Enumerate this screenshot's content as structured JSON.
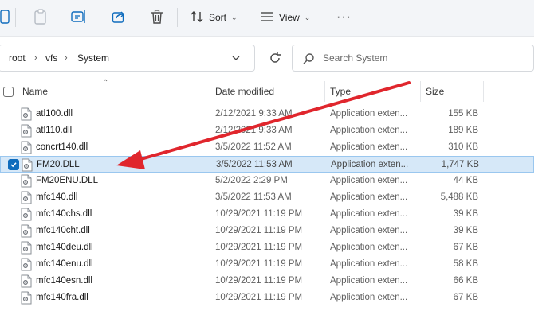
{
  "toolbar": {
    "sort_label": "Sort",
    "view_label": "View",
    "more_label": "···"
  },
  "address": {
    "crumbs": [
      "root",
      "vfs",
      "System"
    ]
  },
  "search": {
    "placeholder": "Search System"
  },
  "columns": {
    "name": "Name",
    "date": "Date modified",
    "type": "Type",
    "size": "Size"
  },
  "files": [
    {
      "name": "atl100.dll",
      "date": "2/12/2021 9:33 AM",
      "type": "Application exten...",
      "size": "155 KB"
    },
    {
      "name": "atl110.dll",
      "date": "2/12/2021 9:33 AM",
      "type": "Application exten...",
      "size": "189 KB"
    },
    {
      "name": "concrt140.dll",
      "date": "3/5/2022 11:52 AM",
      "type": "Application exten...",
      "size": "310 KB"
    },
    {
      "name": "FM20.DLL",
      "date": "3/5/2022 11:53 AM",
      "type": "Application exten...",
      "size": "1,747 KB",
      "selected": true
    },
    {
      "name": "FM20ENU.DLL",
      "date": "5/2/2022 2:29 PM",
      "type": "Application exten...",
      "size": "44 KB"
    },
    {
      "name": "mfc140.dll",
      "date": "3/5/2022 11:53 AM",
      "type": "Application exten...",
      "size": "5,488 KB"
    },
    {
      "name": "mfc140chs.dll",
      "date": "10/29/2021 11:19 PM",
      "type": "Application exten...",
      "size": "39 KB"
    },
    {
      "name": "mfc140cht.dll",
      "date": "10/29/2021 11:19 PM",
      "type": "Application exten...",
      "size": "39 KB"
    },
    {
      "name": "mfc140deu.dll",
      "date": "10/29/2021 11:19 PM",
      "type": "Application exten...",
      "size": "67 KB"
    },
    {
      "name": "mfc140enu.dll",
      "date": "10/29/2021 11:19 PM",
      "type": "Application exten...",
      "size": "58 KB"
    },
    {
      "name": "mfc140esn.dll",
      "date": "10/29/2021 11:19 PM",
      "type": "Application exten...",
      "size": "66 KB"
    },
    {
      "name": "mfc140fra.dll",
      "date": "10/29/2021 11:19 PM",
      "type": "Application exten...",
      "size": "67 KB"
    }
  ],
  "colors": {
    "accent": "#0f6cbd",
    "selection_bg": "#d6e8f8",
    "arrow": "#e0262d"
  },
  "icons": [
    "new-icon",
    "paste-icon",
    "rename-icon",
    "share-icon",
    "delete-icon",
    "sort-icon",
    "view-icon",
    "refresh-icon",
    "search-icon",
    "dll-file-icon"
  ]
}
